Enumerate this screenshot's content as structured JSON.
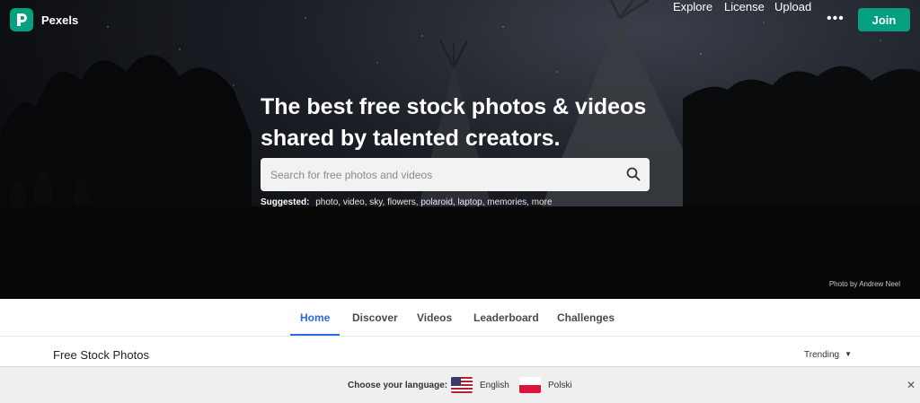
{
  "brand": {
    "name": "Pexels",
    "accent_color": "#05a081"
  },
  "nav": {
    "explore": "Explore",
    "license": "License",
    "upload": "Upload",
    "more": "•••",
    "join": "Join"
  },
  "hero": {
    "headline_line1": "The best free stock photos & videos",
    "headline_line2": "shared by talented creators.",
    "search": {
      "placeholder": "Search for free photos and videos",
      "value": ""
    },
    "suggested_label": "Suggested:",
    "suggested_terms": "photo, video, sky, flowers, polaroid, laptop, memories, more",
    "credit": "Photo by Andrew Neel"
  },
  "tabs": [
    {
      "label": "Home",
      "active": true
    },
    {
      "label": "Discover"
    },
    {
      "label": "Videos"
    },
    {
      "label": "Leaderboard"
    },
    {
      "label": "Challenges"
    }
  ],
  "section": {
    "title": "Free Stock Photos",
    "sort": "Trending"
  },
  "language_bar": {
    "label": "Choose your language:",
    "options": [
      {
        "label": "English",
        "flag": "us-flag-icon"
      },
      {
        "label": "Polski",
        "flag": "pl-flag-icon"
      }
    ],
    "close": "✕"
  },
  "colors": {
    "active_tab": "#2b6be0",
    "join_button": "#05a081"
  }
}
